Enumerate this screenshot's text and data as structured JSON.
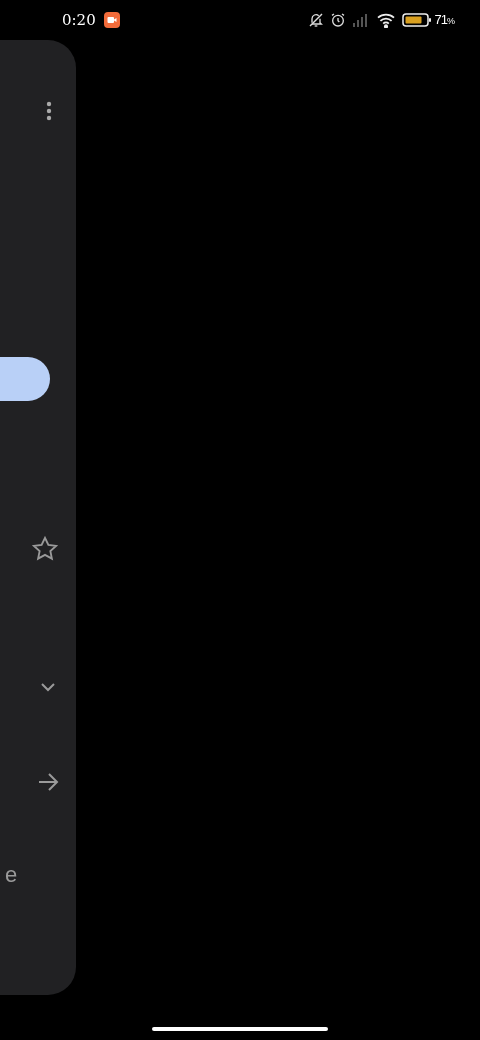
{
  "status_bar": {
    "time": "0:20",
    "battery": "71",
    "battery_unit": "%"
  },
  "card": {
    "partial_text": "e"
  }
}
